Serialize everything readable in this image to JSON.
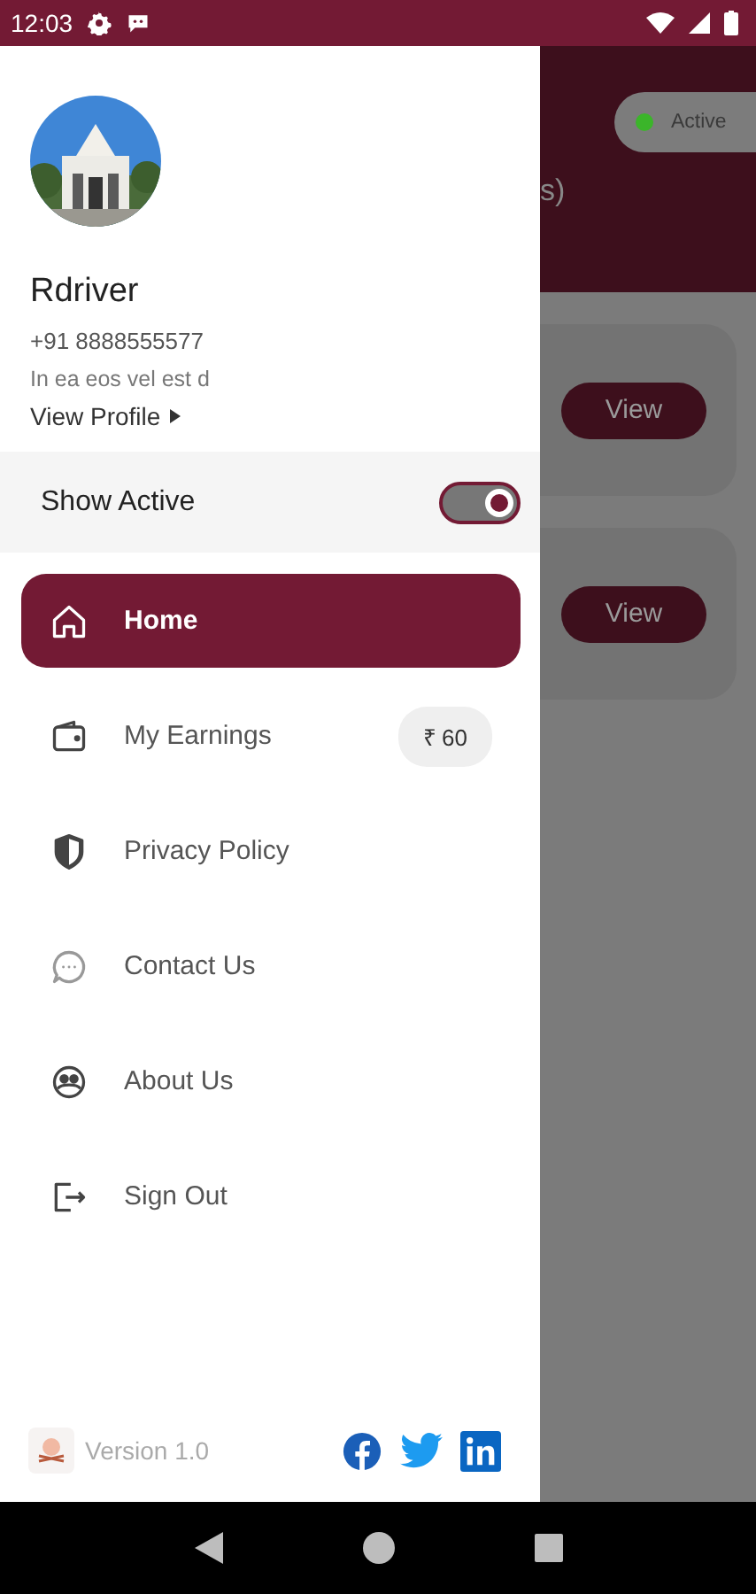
{
  "status_bar": {
    "time": "12:03"
  },
  "profile": {
    "name": "Rdriver",
    "phone": "+91 8888555577",
    "bio": "In ea eos vel est d",
    "link": "View Profile"
  },
  "show_active": {
    "label": "Show Active",
    "on": true
  },
  "menu": [
    {
      "label": "Home",
      "selected": true
    },
    {
      "label": "My Earnings",
      "selected": false,
      "badge": "₹ 60"
    },
    {
      "label": "Privacy Policy",
      "selected": false
    },
    {
      "label": "Contact Us",
      "selected": false
    },
    {
      "label": "About Us",
      "selected": false
    },
    {
      "label": "Sign Out",
      "selected": false
    }
  ],
  "footer": {
    "version": "Version 1.0"
  },
  "background": {
    "status_pill": {
      "label": "Active",
      "color": "#3bb52a"
    },
    "header_fragment": "s)",
    "cards": [
      {
        "button": "View"
      },
      {
        "button": "View"
      }
    ]
  }
}
